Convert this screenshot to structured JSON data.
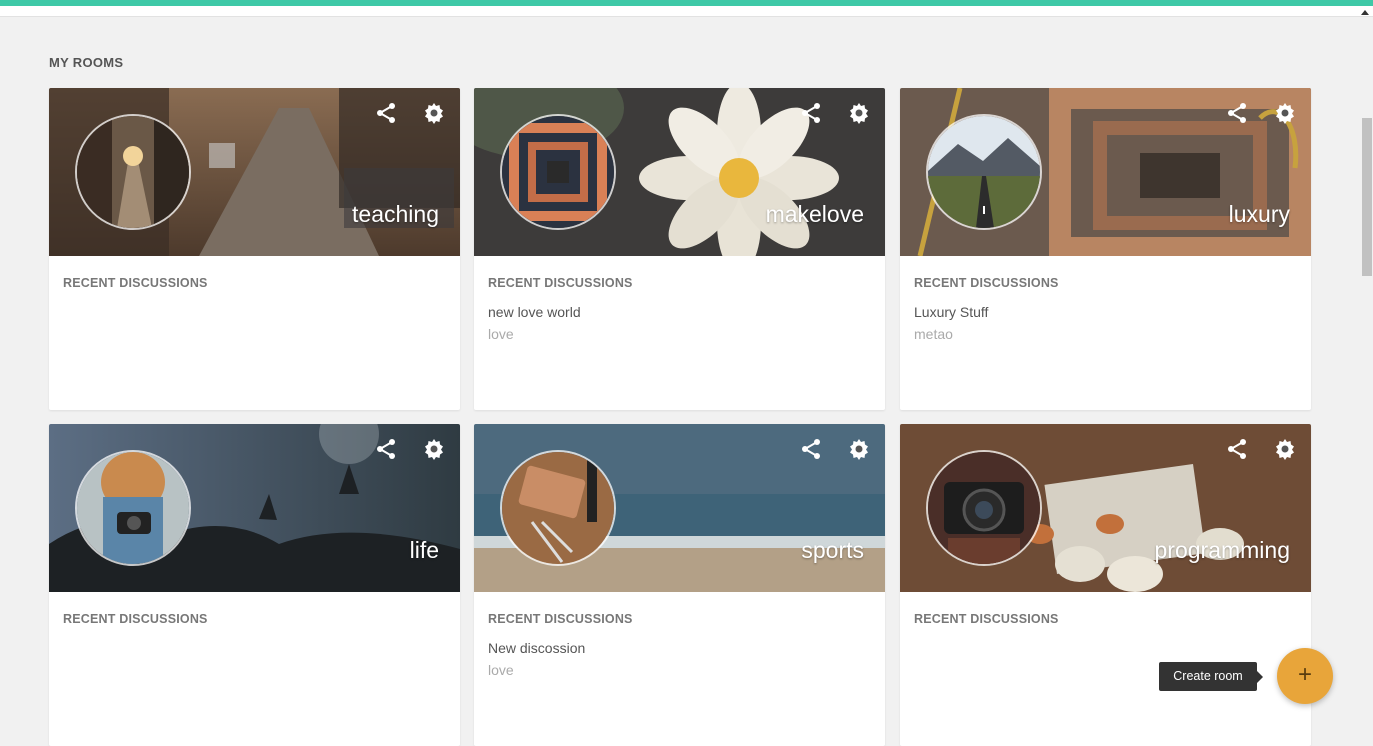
{
  "section_title": "MY ROOMS",
  "rooms": [
    {
      "name": "teaching",
      "recent_label": "RECENT DISCUSSIONS",
      "discussion_title": "",
      "discussion_sub": ""
    },
    {
      "name": "makelove",
      "recent_label": "RECENT DISCUSSIONS",
      "discussion_title": "new love world",
      "discussion_sub": "love"
    },
    {
      "name": "luxury",
      "recent_label": "RECENT DISCUSSIONS",
      "discussion_title": "Luxury Stuff",
      "discussion_sub": "metao"
    },
    {
      "name": "life",
      "recent_label": "RECENT DISCUSSIONS",
      "discussion_title": "",
      "discussion_sub": ""
    },
    {
      "name": "sports",
      "recent_label": "RECENT DISCUSSIONS",
      "discussion_title": "New discossion",
      "discussion_sub": "love"
    },
    {
      "name": "programming",
      "recent_label": "RECENT DISCUSSIONS",
      "discussion_title": "",
      "discussion_sub": ""
    }
  ],
  "fab": {
    "icon": "plus-icon",
    "tooltip": "Create room"
  },
  "colors": {
    "accent_bar": "#3ec9a7",
    "fab": "#e8a53a"
  }
}
